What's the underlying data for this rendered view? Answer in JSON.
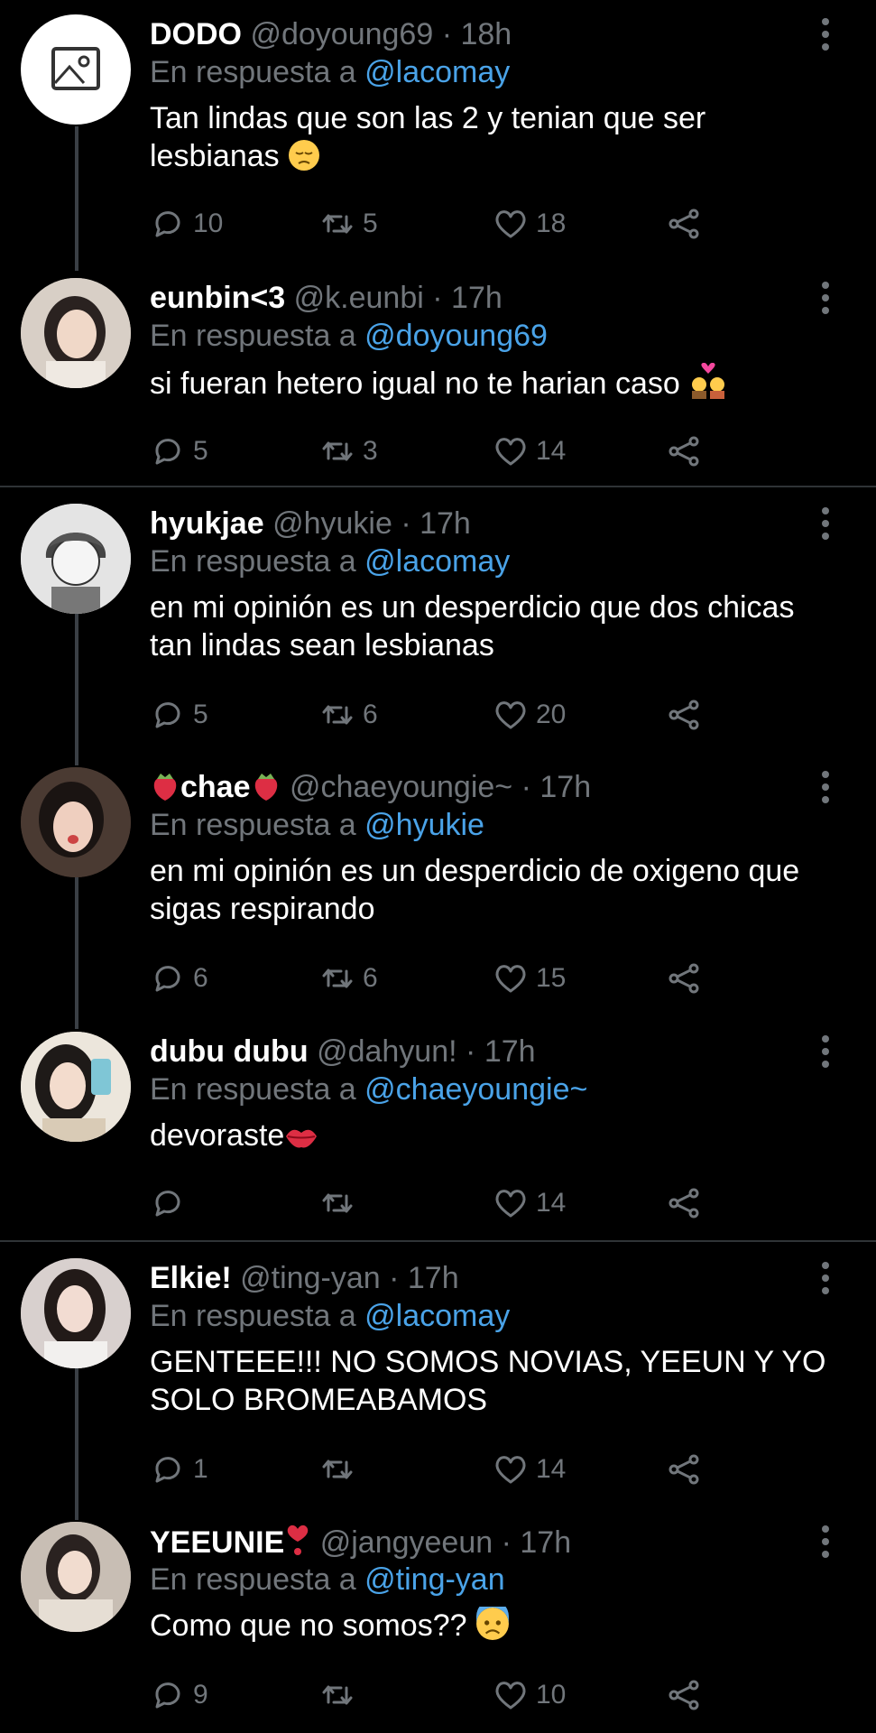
{
  "reply_prefix": "En respuesta a",
  "colors": {
    "background": "#000000",
    "text": "#e7e9ea",
    "muted": "#71767b",
    "mention": "#4aa3e8",
    "thread_line": "#3a3f45",
    "divider": "#2f3336"
  },
  "tweets": [
    {
      "name": "DODO",
      "handle": "@doyoung69",
      "time": "18h",
      "reply_to": "@lacomay",
      "text": "Tan lindas que son las 2 y tenian que ser lesbianas",
      "emoji": "pensive-face",
      "replies": "10",
      "retweets": "5",
      "likes": "18"
    },
    {
      "name": "eunbin<3",
      "handle": "@k.eunbi",
      "time": "17h",
      "reply_to": "@doyoung69",
      "text": "si fueran hetero igual no te harian caso",
      "emoji": "couple-with-heart",
      "replies": "5",
      "retweets": "3",
      "likes": "14"
    },
    {
      "name": "hyukjae",
      "handle": "@hyukie",
      "time": "17h",
      "reply_to": "@lacomay",
      "text": "en mi opinión es un desperdicio que dos chicas tan lindas sean lesbianas",
      "replies": "5",
      "retweets": "6",
      "likes": "20"
    },
    {
      "name": "chae",
      "name_emoji": "strawberry",
      "handle": "@chaeyoungie~",
      "time": "17h",
      "reply_to": "@hyukie",
      "text": "en mi opinión es un desperdicio de oxigeno que sigas respirando",
      "replies": "6",
      "retweets": "6",
      "likes": "15"
    },
    {
      "name": "dubu dubu",
      "handle": "@dahyun!",
      "time": "17h",
      "reply_to": "@chaeyoungie~",
      "text": "devoraste",
      "emoji": "kiss-mark",
      "replies": "",
      "retweets": "",
      "likes": "14"
    },
    {
      "name": "Elkie!",
      "handle": "@ting-yan",
      "time": "17h",
      "reply_to": "@lacomay",
      "text": "GENTEEE!!! NO SOMOS NOVIAS, YEEUN Y YO SOLO BROMEABAMOS",
      "replies": "1",
      "retweets": "",
      "likes": "14"
    },
    {
      "name": "YEEUNIE",
      "name_emoji": "heart-exclamation",
      "handle": "@jangyeeun",
      "time": "17h",
      "reply_to": "@ting-yan",
      "text": "Como que no somos??",
      "emoji": "anxious-face",
      "replies": "9",
      "retweets": "",
      "likes": "10"
    }
  ]
}
